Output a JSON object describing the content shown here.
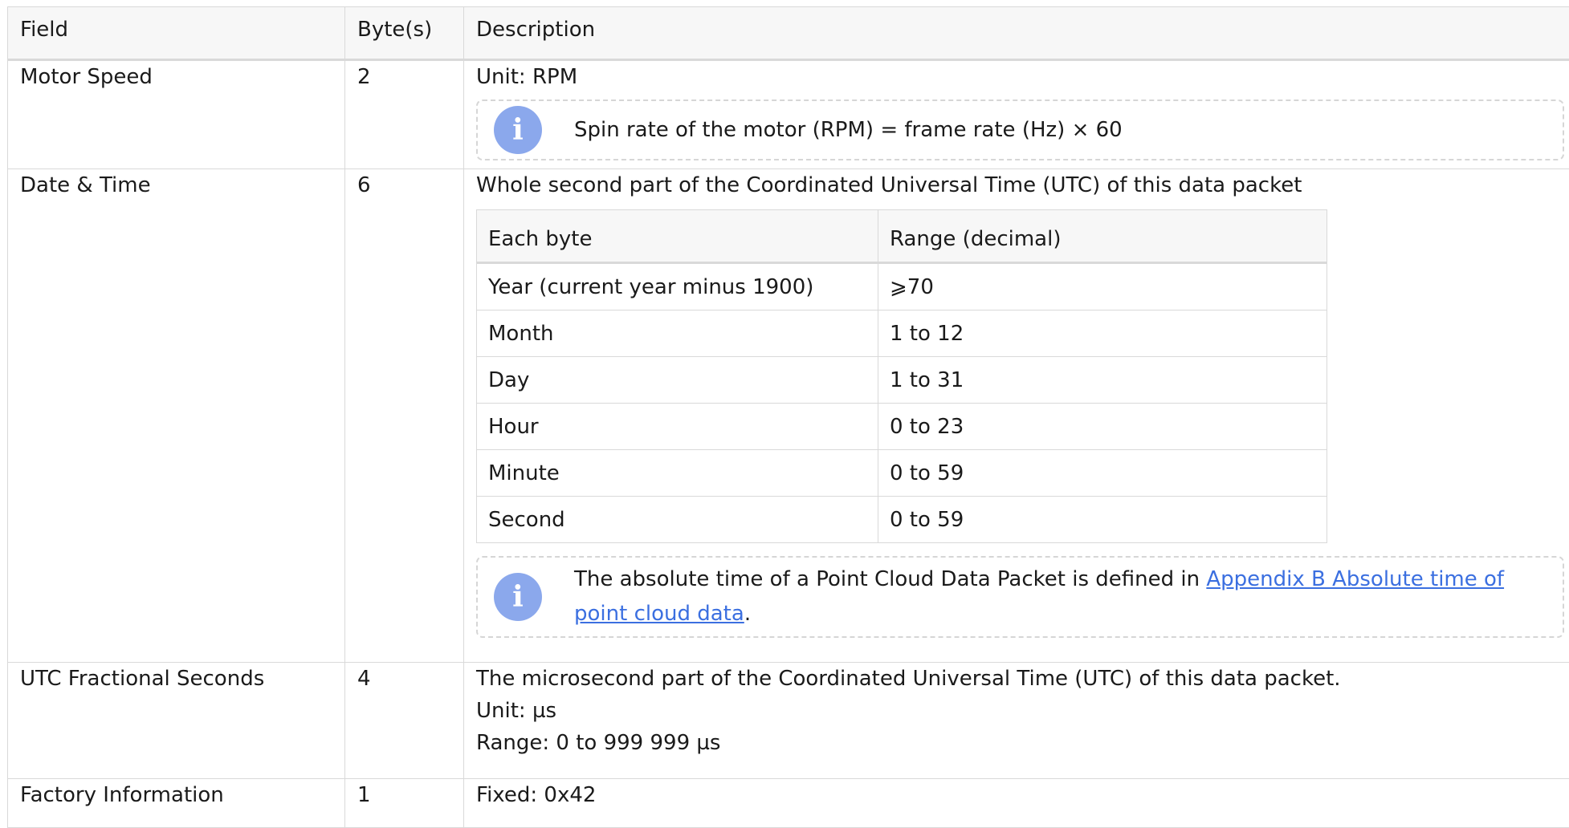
{
  "table": {
    "headers": {
      "field": "Field",
      "bytes": "Byte(s)",
      "description": "Description"
    },
    "rows": {
      "motor_speed": {
        "field": "Motor Speed",
        "bytes": "2",
        "desc": "Unit: RPM",
        "note": "Spin rate of the motor (RPM) = frame rate (Hz) × 60"
      },
      "date_time": {
        "field": "Date & Time",
        "bytes": "6",
        "desc": "Whole second part of the Coordinated Universal Time (UTC) of this data packet",
        "sub_table": {
          "headers": {
            "each_byte": "Each byte",
            "range": "Range (decimal)"
          },
          "rows": [
            {
              "byte": "Year (current year minus 1900)",
              "range": "⩾70"
            },
            {
              "byte": "Month",
              "range": "1 to 12"
            },
            {
              "byte": "Day",
              "range": "1 to 31"
            },
            {
              "byte": "Hour",
              "range": "0 to 23"
            },
            {
              "byte": "Minute",
              "range": "0 to 59"
            },
            {
              "byte": "Second",
              "range": "0 to 59"
            }
          ]
        },
        "note_prefix": "The absolute time of a Point Cloud Data Packet is defined in ",
        "note_link": "Appendix B Absolute time of point cloud data",
        "note_suffix": "."
      },
      "utc_fraction": {
        "field": "UTC Fractional Seconds",
        "bytes": "4",
        "desc_line1": "The microsecond part of the Coordinated Universal Time (UTC) of this data packet.",
        "desc_line2": "Unit: µs",
        "desc_line3": "Range: 0 to 999 999 µs"
      },
      "factory_info": {
        "field": "Factory Information",
        "bytes": "1",
        "desc": "Fixed: 0x42"
      }
    }
  },
  "icons": {
    "info": "info-icon"
  },
  "colors": {
    "info_icon": "#8ba8ec",
    "link": "#3b6fe0",
    "border": "#d9d9d9",
    "header_bg": "#f7f7f7"
  }
}
